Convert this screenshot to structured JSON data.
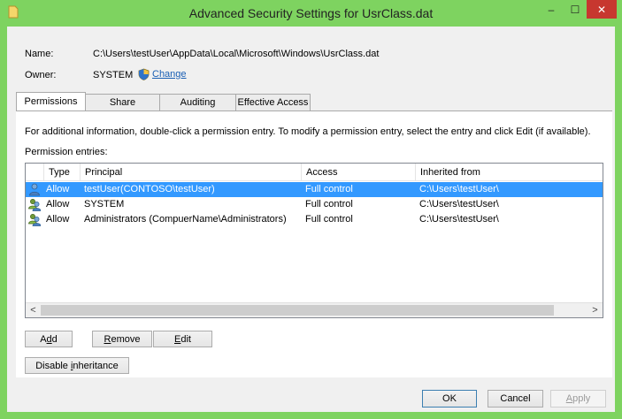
{
  "window": {
    "title": "Advanced Security Settings for UsrClass.dat",
    "minimize": "–",
    "maximize": "☐",
    "close": "✕"
  },
  "fields": {
    "name_label": "Name:",
    "name_value": "C:\\Users\\testUser\\AppData\\Local\\Microsoft\\Windows\\UsrClass.dat",
    "owner_label": "Owner:",
    "owner_value": "SYSTEM",
    "change_link": "Change"
  },
  "tabs": [
    {
      "label": "Permissions",
      "active": true
    },
    {
      "label": "Share",
      "active": false
    },
    {
      "label": "Auditing",
      "active": false
    },
    {
      "label": "Effective Access",
      "active": false
    }
  ],
  "permissions": {
    "info_text": "For additional information, double-click a permission entry. To modify a permission entry, select the entry and click Edit (if available).",
    "entries_label": "Permission entries:",
    "columns": [
      "Type",
      "Principal",
      "Access",
      "Inherited from"
    ],
    "rows": [
      {
        "type": "Allow",
        "principal": "testUser(CONTOSO\\testUser)",
        "access": "Full control",
        "inherited": "C:\\Users\\testUser\\",
        "icon": "user-icon",
        "selected": true
      },
      {
        "type": "Allow",
        "principal": "SYSTEM",
        "access": "Full control",
        "inherited": "C:\\Users\\testUser\\",
        "icon": "group-icon",
        "selected": false
      },
      {
        "type": "Allow",
        "principal": "Administrators (CompuerName\\Administrators)",
        "access": "Full control",
        "inherited": "C:\\Users\\testUser\\",
        "icon": "group-icon",
        "selected": false
      }
    ]
  },
  "buttons": {
    "add": {
      "pre": "A",
      "mn": "d",
      "post": "d"
    },
    "remove": {
      "pre": "",
      "mn": "R",
      "post": "emove"
    },
    "edit": {
      "pre": "",
      "mn": "E",
      "post": "dit"
    },
    "disable_inheritance": {
      "pre": "Disable ",
      "mn": "i",
      "post": "nheritance"
    },
    "ok": "OK",
    "cancel": "Cancel",
    "apply": {
      "pre": "",
      "mn": "A",
      "post": "pply"
    }
  },
  "colors": {
    "titlebar": "#7ed360",
    "selection": "#3399ff",
    "close": "#c7372f"
  }
}
